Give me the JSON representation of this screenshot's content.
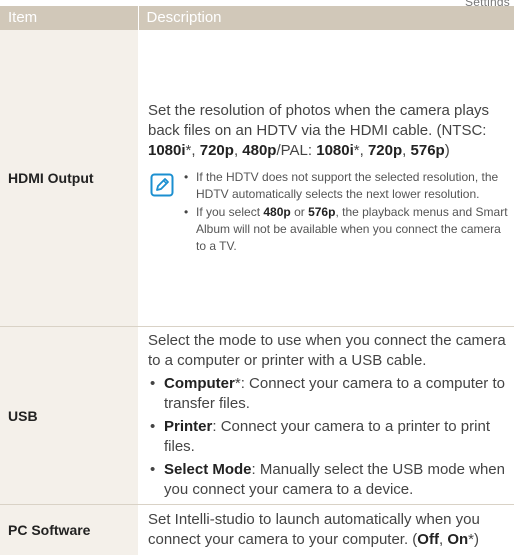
{
  "corner_text": "Settings",
  "header": {
    "item": "Item",
    "description": "Description"
  },
  "rows": {
    "hdmi": {
      "item": "HDMI Output",
      "desc_intro": "Set the resolution of photos when the camera plays back files on an HDTV via the HDMI cable. (NTSC: ",
      "r1080i_a": "1080i",
      "star": "*",
      "sep_comma": ", ",
      "r720p_a": "720p",
      "r480p": "480p",
      "slash_pal": "/PAL: ",
      "r1080i_b": "1080i",
      "r720p_b": "720p",
      "r576p": "576p",
      "close": ")",
      "note1": "If the HDTV does not support the selected resolution, the HDTV automatically selects the next lower resolution.",
      "note2_pre": "If you select ",
      "note2_480": "480p",
      "note2_or": " or ",
      "note2_576": "576p",
      "note2_post": ", the playback menus and Smart Album will not be available when you connect the camera to a TV."
    },
    "usb": {
      "item": "USB",
      "intro": "Select the mode to use when you connect the camera to a computer or printer with a USB cable.",
      "b1_term": "Computer",
      "b1_star": "*",
      "b1_text": ": Connect your camera to a computer to transfer files.",
      "b2_term": "Printer",
      "b2_text": ": Connect your camera to a printer to print files.",
      "b3_term": "Select Mode",
      "b3_text": ": Manually select the USB mode when you connect your camera to a device."
    },
    "pc": {
      "item": "PC Software",
      "text": "Set Intelli-studio to launch automatically when you connect your camera to your computer. (",
      "off": "Off",
      "sep": ", ",
      "on": "On",
      "star": "*",
      "close": ")"
    }
  },
  "icons": {
    "note": "note-pencil-icon"
  },
  "colors": {
    "header_bg": "#d1c8b9",
    "item_col_bg": "#f4f0ea",
    "divider": "#d9d2c6",
    "note_icon": "#1b8fd0"
  }
}
